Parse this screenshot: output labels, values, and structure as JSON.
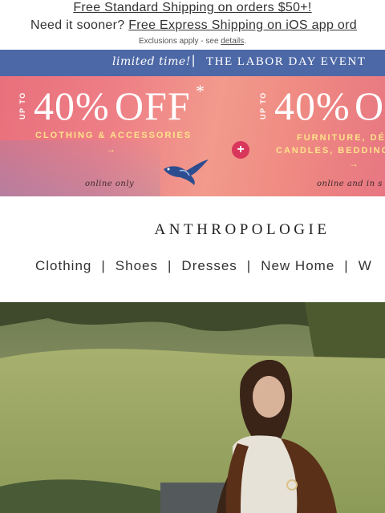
{
  "shipping": {
    "standard_link": "Free Standard Shipping on orders $50+!",
    "express_prefix": "Need it sooner?",
    "express_link": "Free Express Shipping on iOS app ord",
    "exclusions_text": "Exclusions apply - see",
    "exclusions_link": "details",
    "exclusions_end": "."
  },
  "labor_banner": {
    "limited": "limited time!",
    "divider": "|",
    "event": "THE LABOR DAY EVENT"
  },
  "promo": {
    "left": {
      "up_to": "UP TO",
      "discount": "40%",
      "off": "OFF",
      "asterisk": "*",
      "category": "CLOTHING & ACCESSORIES",
      "arrow": "→",
      "availability": "online only"
    },
    "plus": "+",
    "right": {
      "up_to": "UP TO",
      "discount": "40%",
      "off": "O",
      "category_line1": "FURNITURE, DÉ",
      "category_line2": "CANDLES, BEDDING",
      "arrow": "→",
      "availability": "online and in s"
    },
    "colors": {
      "pink": "#ee7f86",
      "yellow": "#ffe38a"
    }
  },
  "brand": {
    "logo": "ANTHROPOLOGIE"
  },
  "nav": {
    "items": [
      "Clothing",
      "Shoes",
      "Dresses",
      "New Home",
      "W"
    ],
    "separator": "|"
  },
  "colors": {
    "labor_blue": "#4d68a6"
  }
}
